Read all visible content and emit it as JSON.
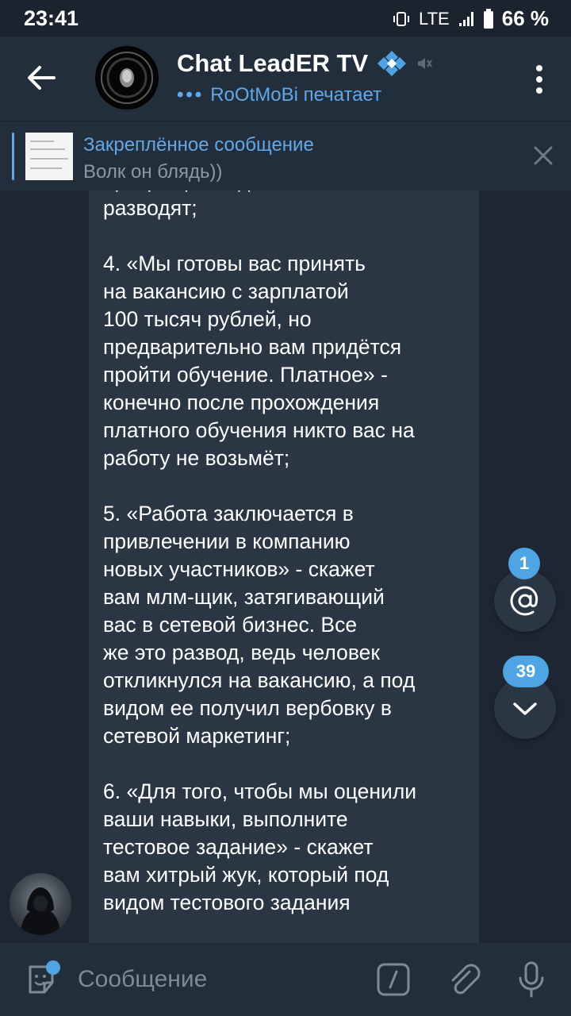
{
  "status_bar": {
    "time": "23:41",
    "network": "LTE",
    "battery": "66 %"
  },
  "header": {
    "title": "Chat LeadER TV",
    "typing_dots": "•••",
    "typing_status": "RoOtMoBi печатает"
  },
  "pinned": {
    "label": "Закреплённое сообщение",
    "text": "Волк он блядь))"
  },
  "message": {
    "text": "слышите про гаранта - сразу\nпрекращайте диалог, вас\nразводят;\n\n4. «Мы готовы вас принять\nна вакансию с зарплатой\n100 тысяч рублей, но\nпредварительно вам придётся\nпройти обучение. Платное» -\nконечно после прохождения\nплатного обучения никто вас на\nработу не возьмёт;\n\n5. «Работа заключается в\nпривлечении в компанию\nновых участников» - скажет\nвам млм-щик, затягивающий\nвас в сетевой бизнес. Все\nже это развод, ведь человек\nоткликнулся на вакансию, а под\nвидом ее получил вербовку в\nсетевой маркетинг;\n\n6. «Для того, чтобы мы оценили\nваши навыки, выполните\nтестовое задание» - скажет\nвам хитрый жук, который под\nвидом тестового задания"
  },
  "badges": {
    "mentions": "1",
    "unread": "39"
  },
  "input": {
    "placeholder": "Сообщение"
  },
  "colors": {
    "accent": "#62a8e8",
    "badge": "#4fa5e4",
    "bubble": "#2b3644",
    "background": "#1d2733",
    "bar": "#232e3c"
  }
}
